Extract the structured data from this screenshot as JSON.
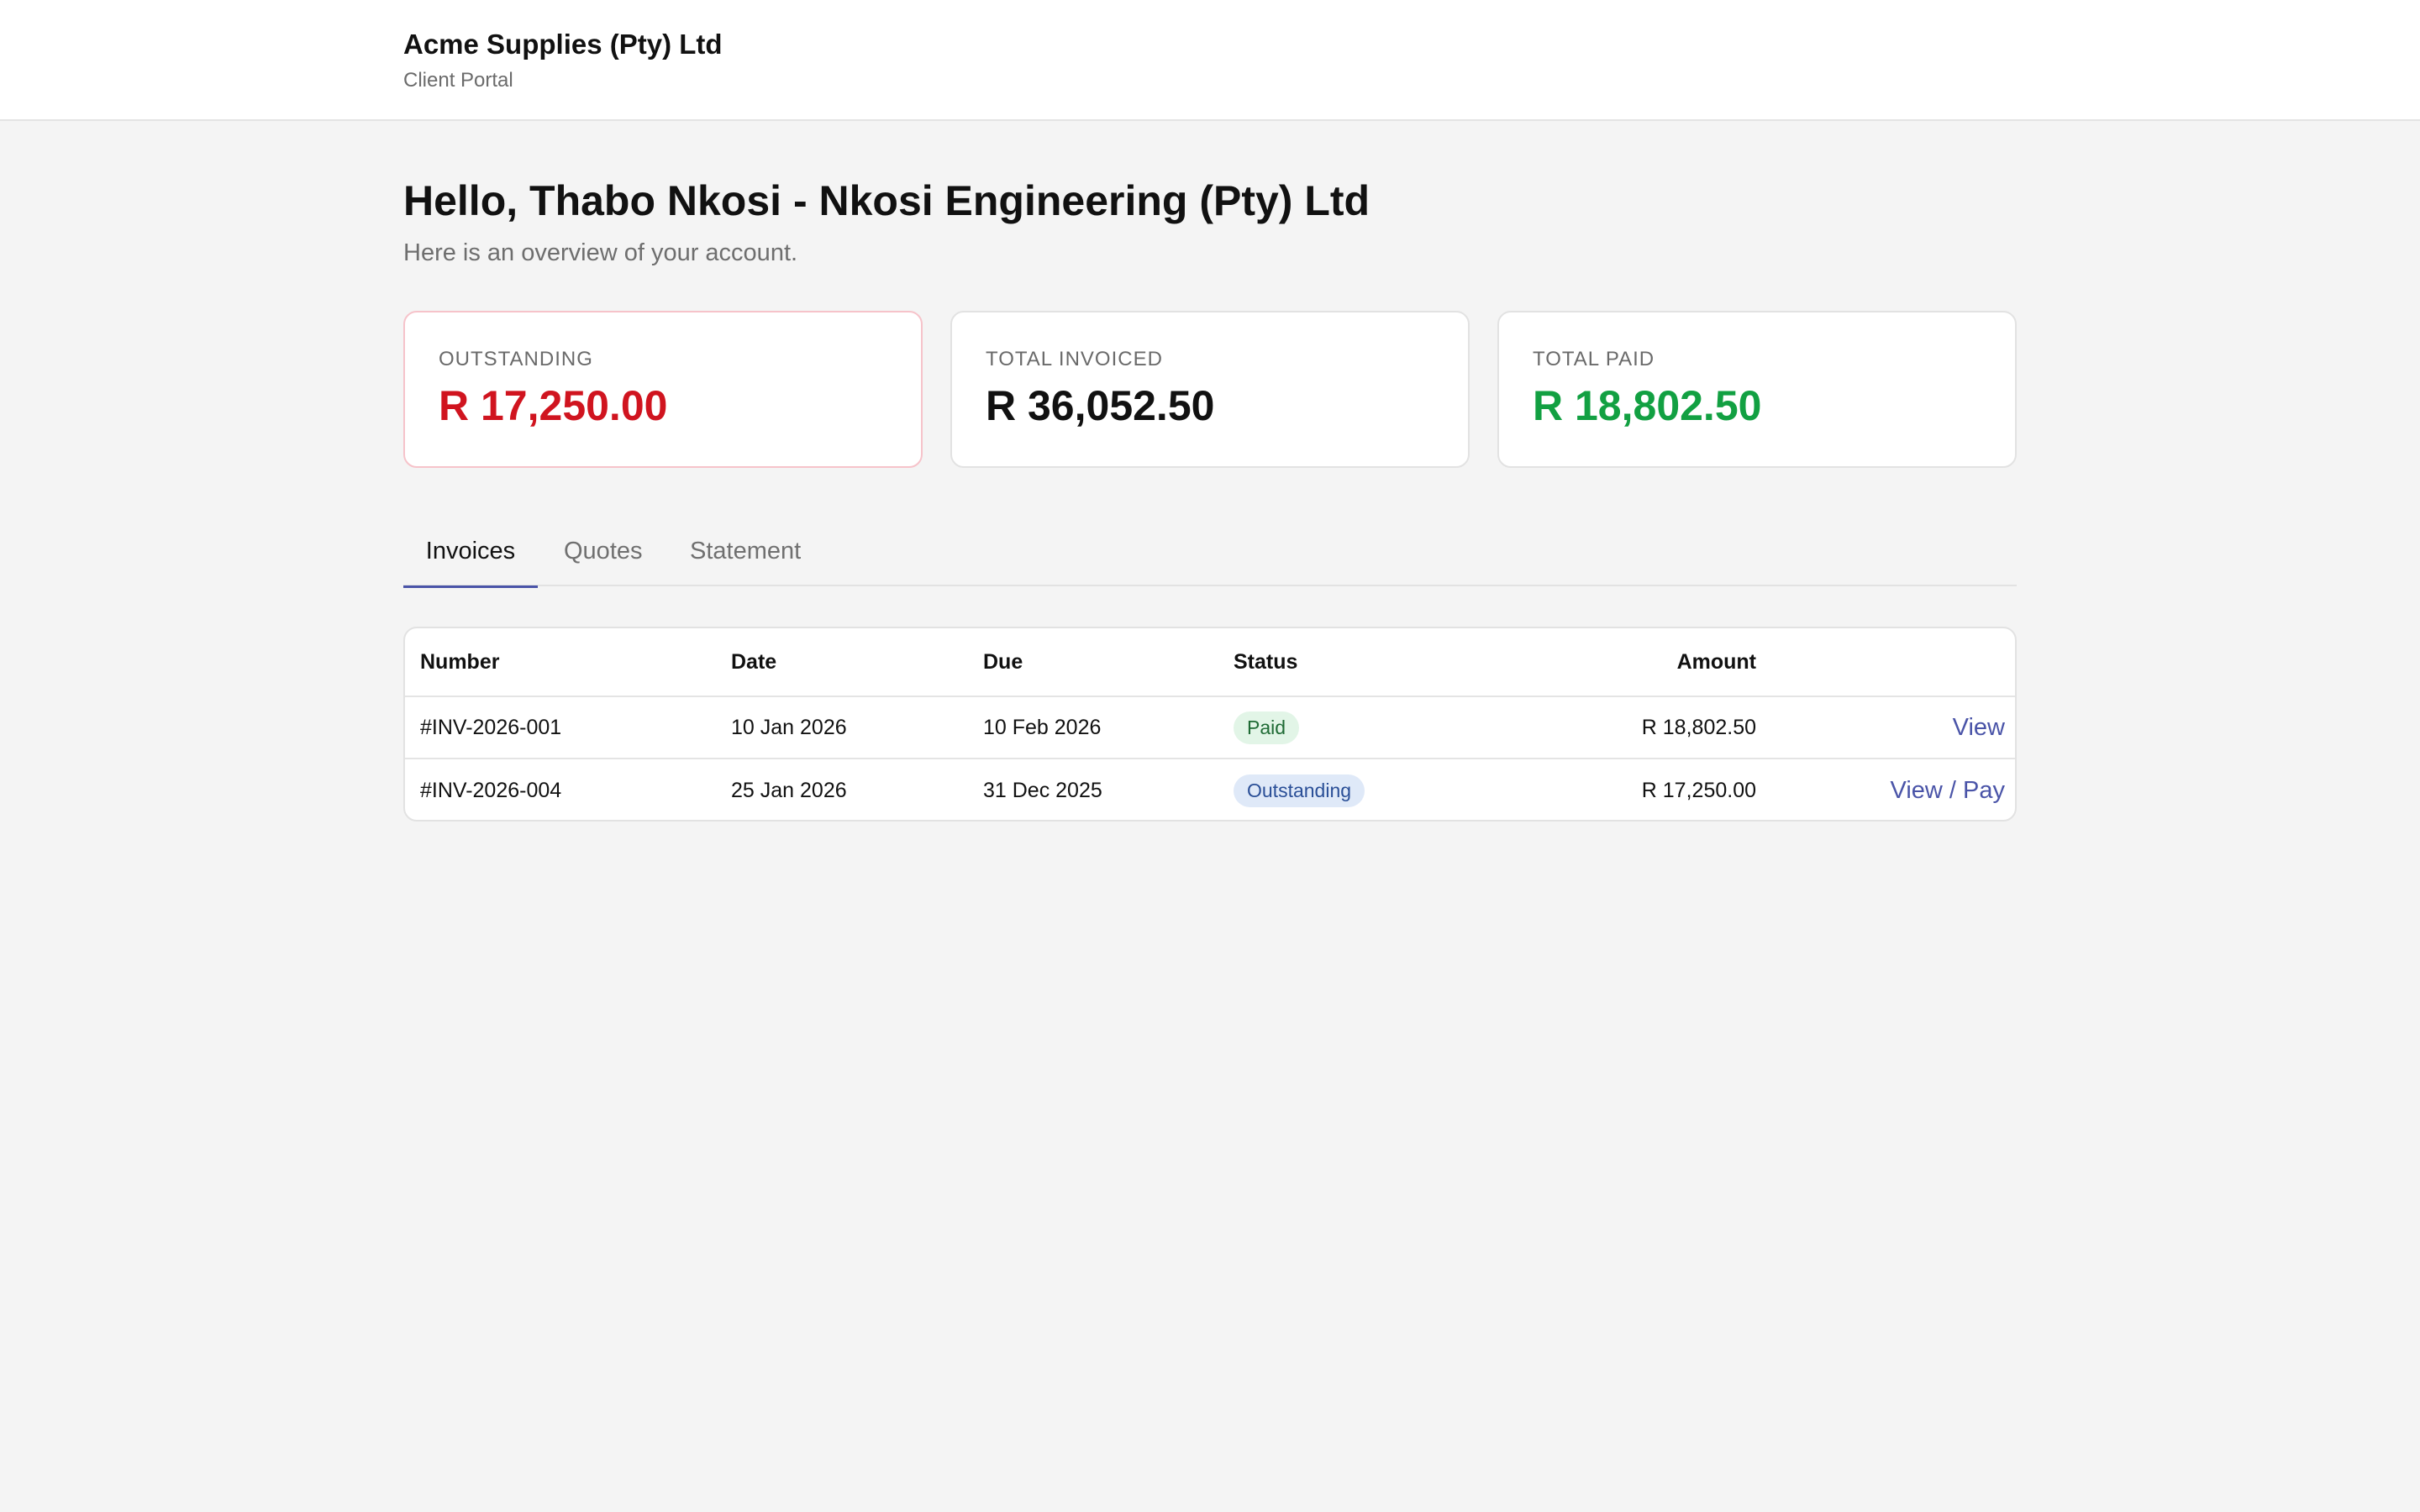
{
  "header": {
    "company_name": "Acme Supplies (Pty) Ltd",
    "portal_label": "Client Portal"
  },
  "main": {
    "greeting": "Hello, Thabo Nkosi - Nkosi Engineering (Pty) Ltd",
    "subtitle": "Here is an overview of your account."
  },
  "summary": {
    "outstanding": {
      "label": "OUTSTANDING",
      "value": "R 17,250.00",
      "color": "#d0141f"
    },
    "total_invoiced": {
      "label": "TOTAL INVOICED",
      "value": "R 36,052.50",
      "color": "#111111"
    },
    "total_paid": {
      "label": "TOTAL PAID",
      "value": "R 18,802.50",
      "color": "#12a042"
    }
  },
  "tabs": [
    {
      "label": "Invoices",
      "active": true
    },
    {
      "label": "Quotes",
      "active": false
    },
    {
      "label": "Statement",
      "active": false
    }
  ],
  "invoices": {
    "columns": [
      "Number",
      "Date",
      "Due",
      "Status",
      "Amount"
    ],
    "rows": [
      {
        "number": "#INV-2026-001",
        "date": "10 Jan 2026",
        "due": "10 Feb 2026",
        "status": "Paid",
        "amount": "R 18,802.50",
        "action": "View"
      },
      {
        "number": "#INV-2026-004",
        "date": "25 Jan 2026",
        "due": "31 Dec 2025",
        "status": "Outstanding",
        "amount": "R 17,250.00",
        "action": "View / Pay"
      }
    ]
  },
  "colors": {
    "accent": "#4a54a8",
    "background": "#f4f4f4",
    "paid_badge_bg": "#e2f5e7",
    "outstanding_badge_bg": "#dfe9f8"
  }
}
